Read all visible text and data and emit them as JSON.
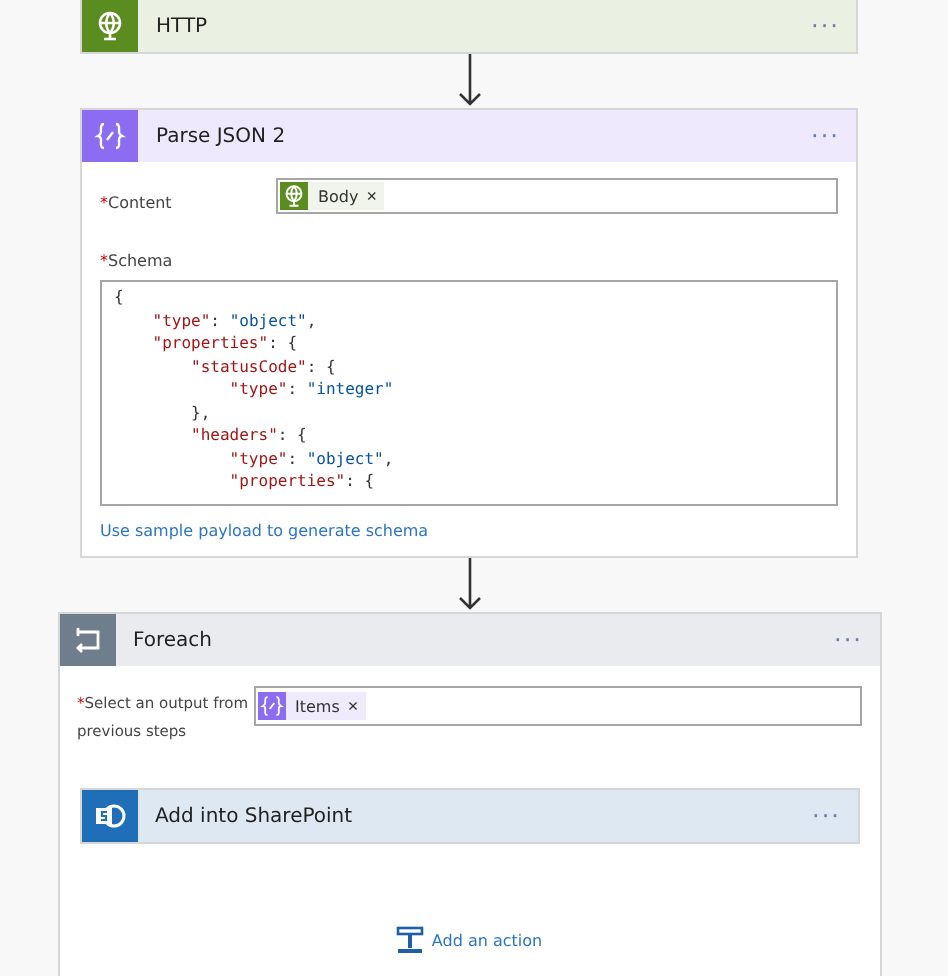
{
  "http_step": {
    "kind": "http",
    "title": "HTTP",
    "menu": "···"
  },
  "parse_step": {
    "kind": "parse",
    "title": "Parse JSON 2",
    "menu": "···",
    "content": {
      "label": "Content",
      "required_mark": "*",
      "token": {
        "kind": "http",
        "label": "Body",
        "remove": "×"
      }
    },
    "schema": {
      "label": "Schema",
      "required_mark": "*",
      "lines": [
        [
          {
            "kind": "punct",
            "text": "{"
          }
        ],
        [
          {
            "kind": "key",
            "text": "    \"type\""
          },
          {
            "kind": "punct",
            "text": ": "
          },
          {
            "kind": "string",
            "text": "\"object\""
          },
          {
            "kind": "punct",
            "text": ","
          }
        ],
        [
          {
            "kind": "key",
            "text": "    \"properties\""
          },
          {
            "kind": "punct",
            "text": ": {"
          }
        ],
        [
          {
            "kind": "key",
            "text": "        \"statusCode\""
          },
          {
            "kind": "punct",
            "text": ": {"
          }
        ],
        [
          {
            "kind": "key",
            "text": "            \"type\""
          },
          {
            "kind": "punct",
            "text": ": "
          },
          {
            "kind": "string",
            "text": "\"integer\""
          }
        ],
        [
          {
            "kind": "punct",
            "text": "        },"
          }
        ],
        [
          {
            "kind": "key",
            "text": "        \"headers\""
          },
          {
            "kind": "punct",
            "text": ": {"
          }
        ],
        [
          {
            "kind": "key",
            "text": "            \"type\""
          },
          {
            "kind": "punct",
            "text": ": "
          },
          {
            "kind": "string",
            "text": "\"object\""
          },
          {
            "kind": "punct",
            "text": ","
          }
        ],
        [
          {
            "kind": "key",
            "text": "            \"properties\""
          },
          {
            "kind": "punct",
            "text": ": {"
          }
        ]
      ]
    },
    "link": "Use sample payload to generate schema"
  },
  "foreach_step": {
    "kind": "foreach",
    "title": "Foreach",
    "menu": "···",
    "output": {
      "label": "Select an output from previous steps",
      "required_mark": "*",
      "token": {
        "kind": "parse",
        "label": "Items",
        "remove": "×"
      }
    },
    "inner_step": {
      "kind": "sharepoint",
      "title": "Add into SharePoint",
      "menu": "···"
    },
    "add_action": "Add an action"
  }
}
